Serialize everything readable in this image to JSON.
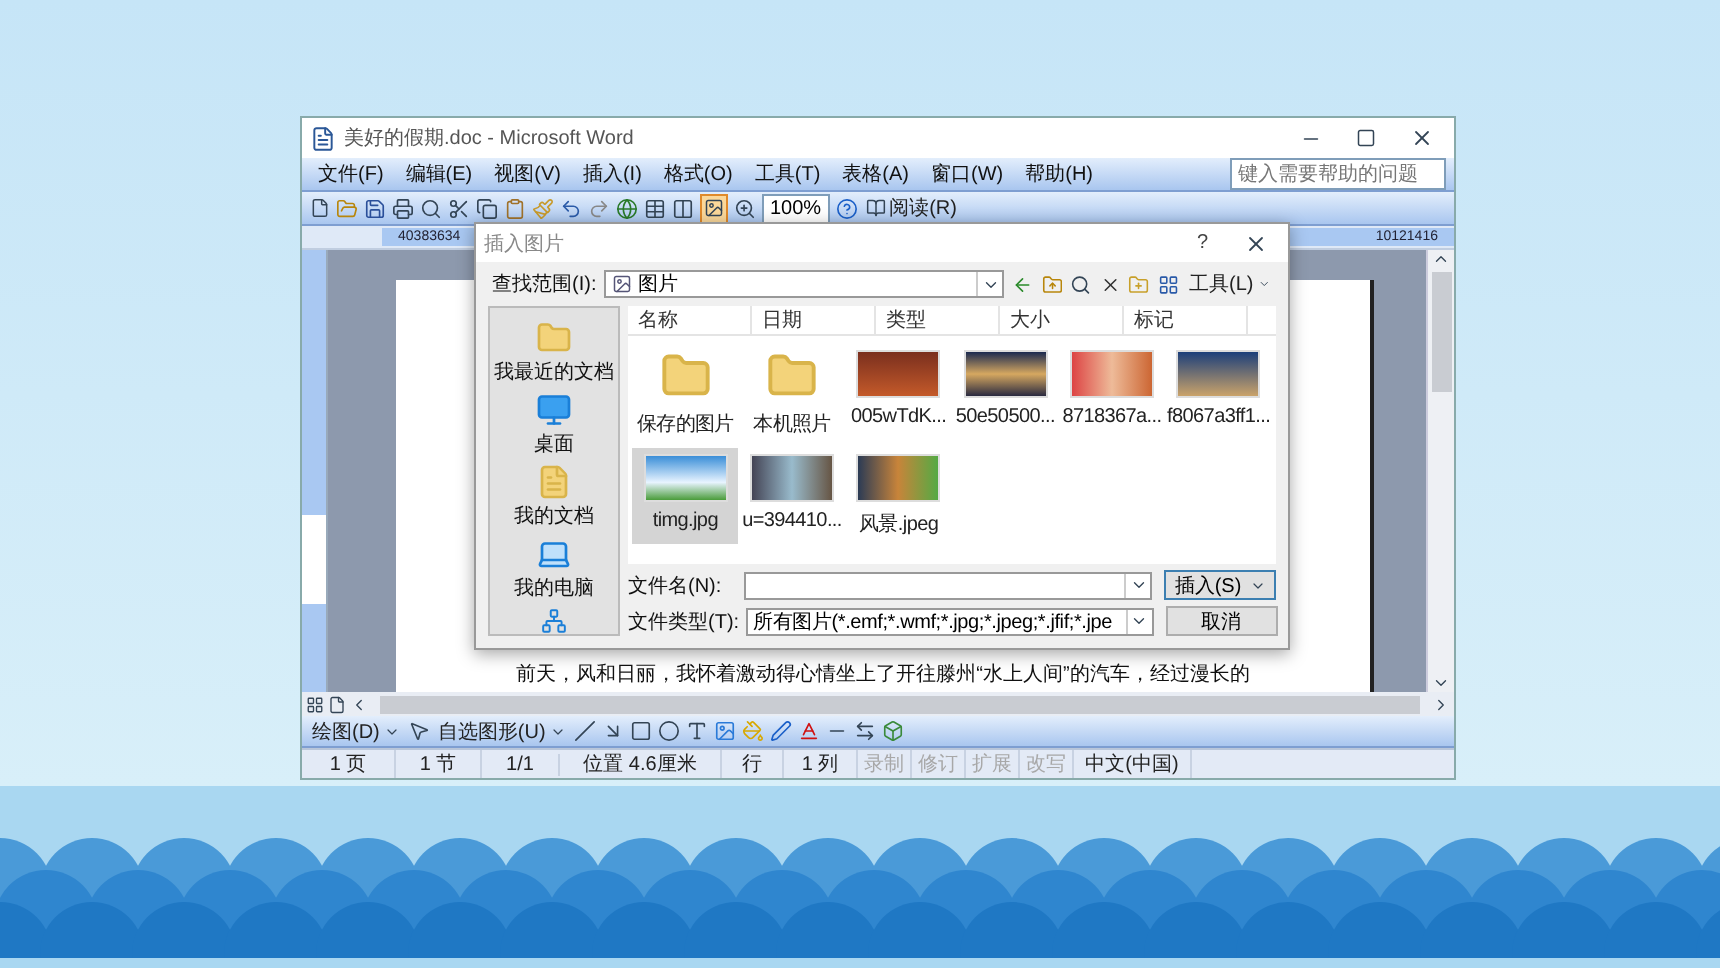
{
  "window": {
    "title": "美好的假期.doc - Microsoft Word"
  },
  "menu": [
    "文件(F)",
    "编辑(E)",
    "视图(V)",
    "插入(I)",
    "格式(O)",
    "工具(T)",
    "表格(A)",
    "窗口(W)",
    "帮助(H)"
  ],
  "help_search": {
    "placeholder": "键入需要帮助的问题"
  },
  "toolbar": {
    "zoom": "100%",
    "read_button": "阅读(R)"
  },
  "ruler": {
    "left_labels": [
      "40",
      "38",
      "36",
      "34"
    ],
    "right_labels": [
      "10",
      "12",
      "14",
      "16"
    ]
  },
  "document": {
    "lines": [
      "前天，风和日丽，我怀着激动得心情坐上了开往滕州“水上人间”的汽车，经过漫长的"
    ]
  },
  "drawing_toolbar": {
    "draw_menu": "绘图(D)",
    "autoshapes_menu": "自选图形(U)"
  },
  "status_bar": [
    {
      "text": "1 页",
      "disabled": false
    },
    {
      "text": "1 节",
      "disabled": false
    },
    {
      "text": "1/1",
      "disabled": false
    },
    {
      "text": "位置 4.6厘米",
      "disabled": false
    },
    {
      "text": "行",
      "disabled": false
    },
    {
      "text": "1 列",
      "disabled": false
    },
    {
      "text": "录制",
      "disabled": true
    },
    {
      "text": "修订",
      "disabled": true
    },
    {
      "text": "扩展",
      "disabled": true
    },
    {
      "text": "改写",
      "disabled": true
    },
    {
      "text": "中文(中国)",
      "disabled": false
    }
  ],
  "dialog": {
    "title": "插入图片",
    "help": "?",
    "look_in_label": "查找范围(I):",
    "look_in_value": "图片",
    "tools_menu": "工具(L)",
    "places": [
      {
        "label": "我最近的文档",
        "kind": "recent"
      },
      {
        "label": "桌面",
        "kind": "desktop"
      },
      {
        "label": "我的文档",
        "kind": "documents"
      },
      {
        "label": "我的电脑",
        "kind": "computer"
      }
    ],
    "columns": [
      "名称",
      "日期",
      "类型",
      "大小",
      "标记"
    ],
    "files": [
      {
        "name": "保存的图片",
        "kind": "folder",
        "selected": false
      },
      {
        "name": "本机照片",
        "kind": "folder",
        "selected": false
      },
      {
        "name": "005wTdK...",
        "kind": "image",
        "selected": false
      },
      {
        "name": "50e50500...",
        "kind": "image",
        "selected": false
      },
      {
        "name": "8718367a...",
        "kind": "image",
        "selected": false
      },
      {
        "name": "f8067a3ff1...",
        "kind": "image",
        "selected": false
      },
      {
        "name": "timg.jpg",
        "kind": "image",
        "selected": true
      },
      {
        "name": "u=394410...",
        "kind": "image",
        "selected": false
      },
      {
        "name": "风景.jpeg",
        "kind": "image",
        "selected": false
      }
    ],
    "file_name_label": "文件名(N):",
    "file_type_label": "文件类型(T):",
    "file_type_value": "所有图片(*.emf;*.wmf;*.jpg;*.jpeg;*.jfif;*.jpe",
    "buttons": [
      {
        "label": "插入(S)",
        "kind": "split"
      },
      {
        "label": "取消",
        "kind": "plain"
      }
    ]
  }
}
